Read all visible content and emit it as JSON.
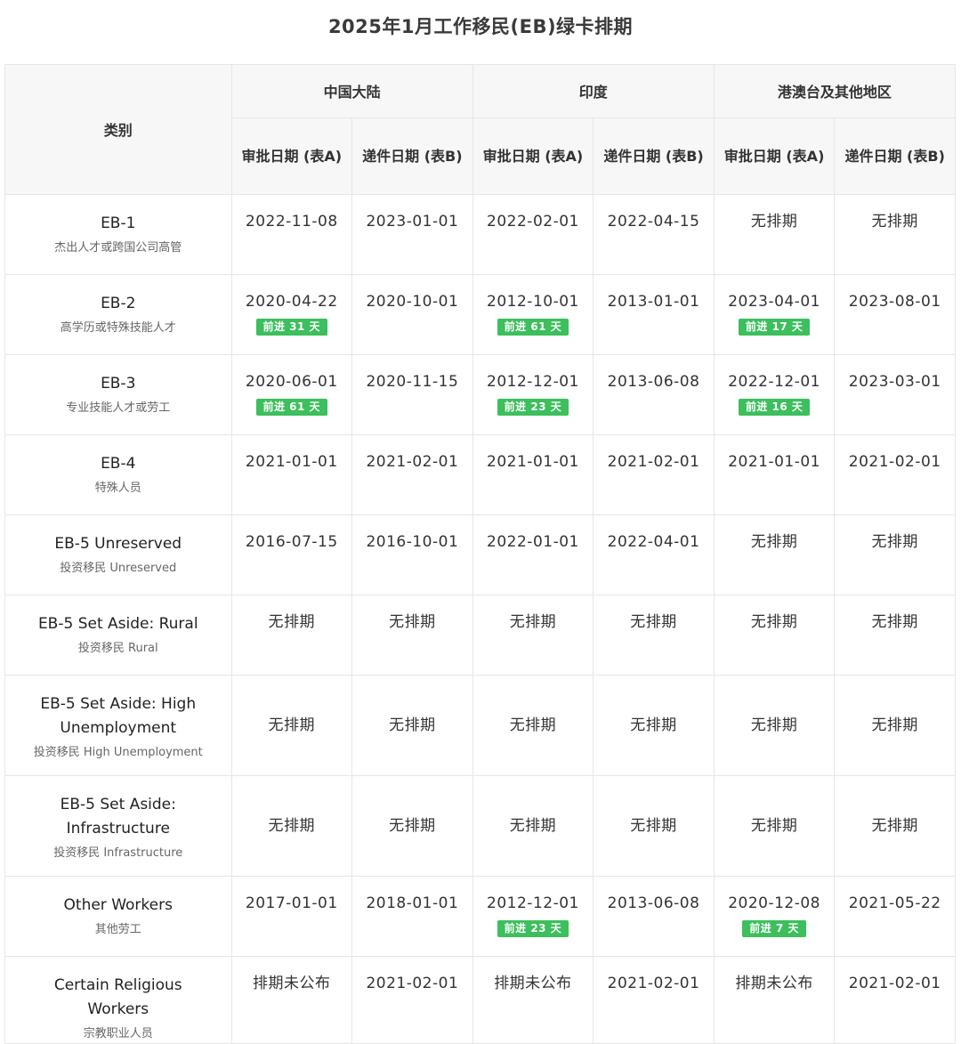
{
  "title": "2025年1月工作移民(EB)绿卡排期",
  "header": {
    "category_label": "类别",
    "regions": [
      "中国大陆",
      "印度",
      "港澳台及其他地区"
    ],
    "sub_headers": [
      "审批日期 (表A)",
      "递件日期 (表B)",
      "审批日期 (表A)",
      "递件日期 (表B)",
      "审批日期 (表A)",
      "递件日期 (表B)"
    ]
  },
  "rows": [
    {
      "en": "EB-1",
      "zh": "杰出人才或跨国公司高管",
      "cells": [
        {
          "v": "2022-11-08"
        },
        {
          "v": "2023-01-01"
        },
        {
          "v": "2022-02-01"
        },
        {
          "v": "2022-04-15"
        },
        {
          "v": "无排期"
        },
        {
          "v": "无排期"
        }
      ]
    },
    {
      "en": "EB-2",
      "zh": "高学历或特殊技能人才",
      "cells": [
        {
          "v": "2020-04-22",
          "b": "前进 31 天"
        },
        {
          "v": "2020-10-01"
        },
        {
          "v": "2012-10-01",
          "b": "前进 61 天"
        },
        {
          "v": "2013-01-01"
        },
        {
          "v": "2023-04-01",
          "b": "前进 17 天"
        },
        {
          "v": "2023-08-01"
        }
      ]
    },
    {
      "en": "EB-3",
      "zh": "专业技能人才或劳工",
      "cells": [
        {
          "v": "2020-06-01",
          "b": "前进 61 天"
        },
        {
          "v": "2020-11-15"
        },
        {
          "v": "2012-12-01",
          "b": "前进 23 天"
        },
        {
          "v": "2013-06-08"
        },
        {
          "v": "2022-12-01",
          "b": "前进 16 天"
        },
        {
          "v": "2023-03-01"
        }
      ]
    },
    {
      "en": "EB-4",
      "zh": "特殊人员",
      "cells": [
        {
          "v": "2021-01-01"
        },
        {
          "v": "2021-02-01"
        },
        {
          "v": "2021-01-01"
        },
        {
          "v": "2021-02-01"
        },
        {
          "v": "2021-01-01"
        },
        {
          "v": "2021-02-01"
        }
      ]
    },
    {
      "en": "EB-5 Unreserved",
      "zh": "投资移民 Unreserved",
      "cells": [
        {
          "v": "2016-07-15"
        },
        {
          "v": "2016-10-01"
        },
        {
          "v": "2022-01-01"
        },
        {
          "v": "2022-04-01"
        },
        {
          "v": "无排期"
        },
        {
          "v": "无排期"
        }
      ]
    },
    {
      "en": "EB-5 Set Aside: Rural",
      "zh": "投资移民 Rural",
      "cells": [
        {
          "v": "无排期"
        },
        {
          "v": "无排期"
        },
        {
          "v": "无排期"
        },
        {
          "v": "无排期"
        },
        {
          "v": "无排期"
        },
        {
          "v": "无排期"
        }
      ]
    },
    {
      "en": "EB-5 Set Aside: High Unemployment",
      "zh": "投资移民 High Unemployment",
      "mid": true,
      "cells": [
        {
          "v": "无排期"
        },
        {
          "v": "无排期"
        },
        {
          "v": "无排期"
        },
        {
          "v": "无排期"
        },
        {
          "v": "无排期"
        },
        {
          "v": "无排期"
        }
      ]
    },
    {
      "en": "EB-5 Set Aside: Infrastructure",
      "zh": "投资移民 Infrastructure",
      "mid": true,
      "cells": [
        {
          "v": "无排期"
        },
        {
          "v": "无排期"
        },
        {
          "v": "无排期"
        },
        {
          "v": "无排期"
        },
        {
          "v": "无排期"
        },
        {
          "v": "无排期"
        }
      ]
    },
    {
      "en": "Other Workers",
      "zh": "其他劳工",
      "cells": [
        {
          "v": "2017-01-01"
        },
        {
          "v": "2018-01-01"
        },
        {
          "v": "2012-12-01",
          "b": "前进 23 天"
        },
        {
          "v": "2013-06-08"
        },
        {
          "v": "2020-12-08",
          "b": "前进 7 天"
        },
        {
          "v": "2021-05-22"
        }
      ]
    },
    {
      "en": "Certain Religious Workers",
      "zh": "宗教职业人员",
      "cells": [
        {
          "v": "排期未公布"
        },
        {
          "v": "2021-02-01"
        },
        {
          "v": "排期未公布"
        },
        {
          "v": "2021-02-01"
        },
        {
          "v": "排期未公布"
        },
        {
          "v": "2021-02-01"
        }
      ]
    }
  ]
}
